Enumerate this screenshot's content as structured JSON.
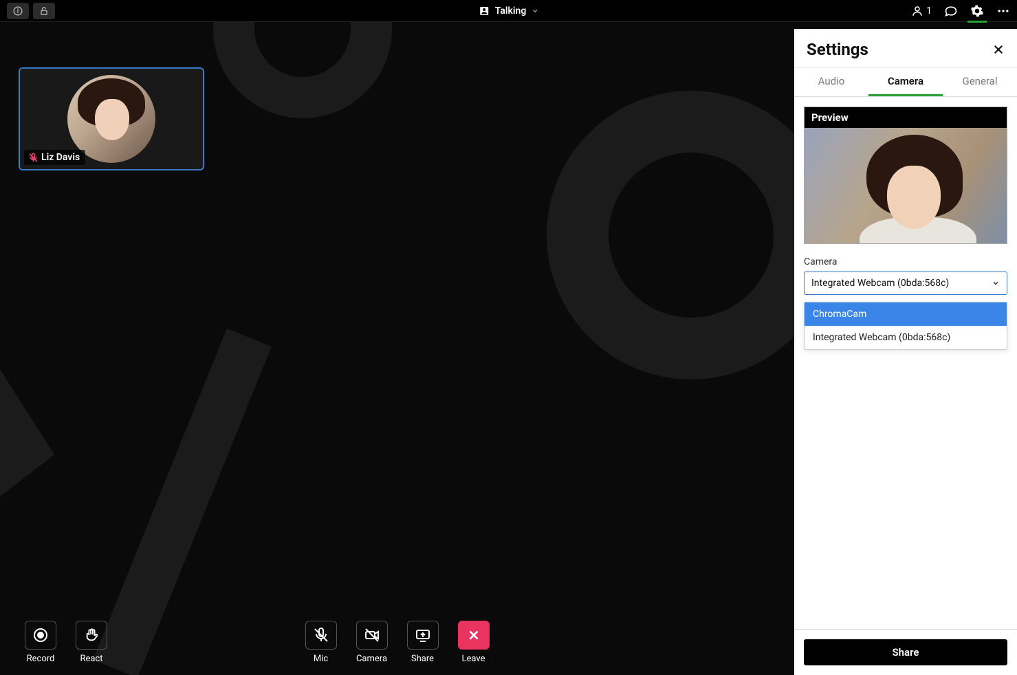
{
  "topbar": {
    "status_label": "Talking",
    "participant_count": "1"
  },
  "participant": {
    "name": "Liz Davis"
  },
  "controls": {
    "record": "Record",
    "react": "React",
    "mic": "Mic",
    "camera": "Camera",
    "share": "Share",
    "leave": "Leave"
  },
  "settings": {
    "title": "Settings",
    "tabs": {
      "audio": "Audio",
      "camera": "Camera",
      "general": "General"
    },
    "preview_label": "Preview",
    "camera_label": "Camera",
    "camera_selected": "Integrated Webcam (0bda:568c)",
    "camera_options": [
      "ChromaCam",
      "Integrated Webcam (0bda:568c)"
    ],
    "share_button": "Share"
  }
}
